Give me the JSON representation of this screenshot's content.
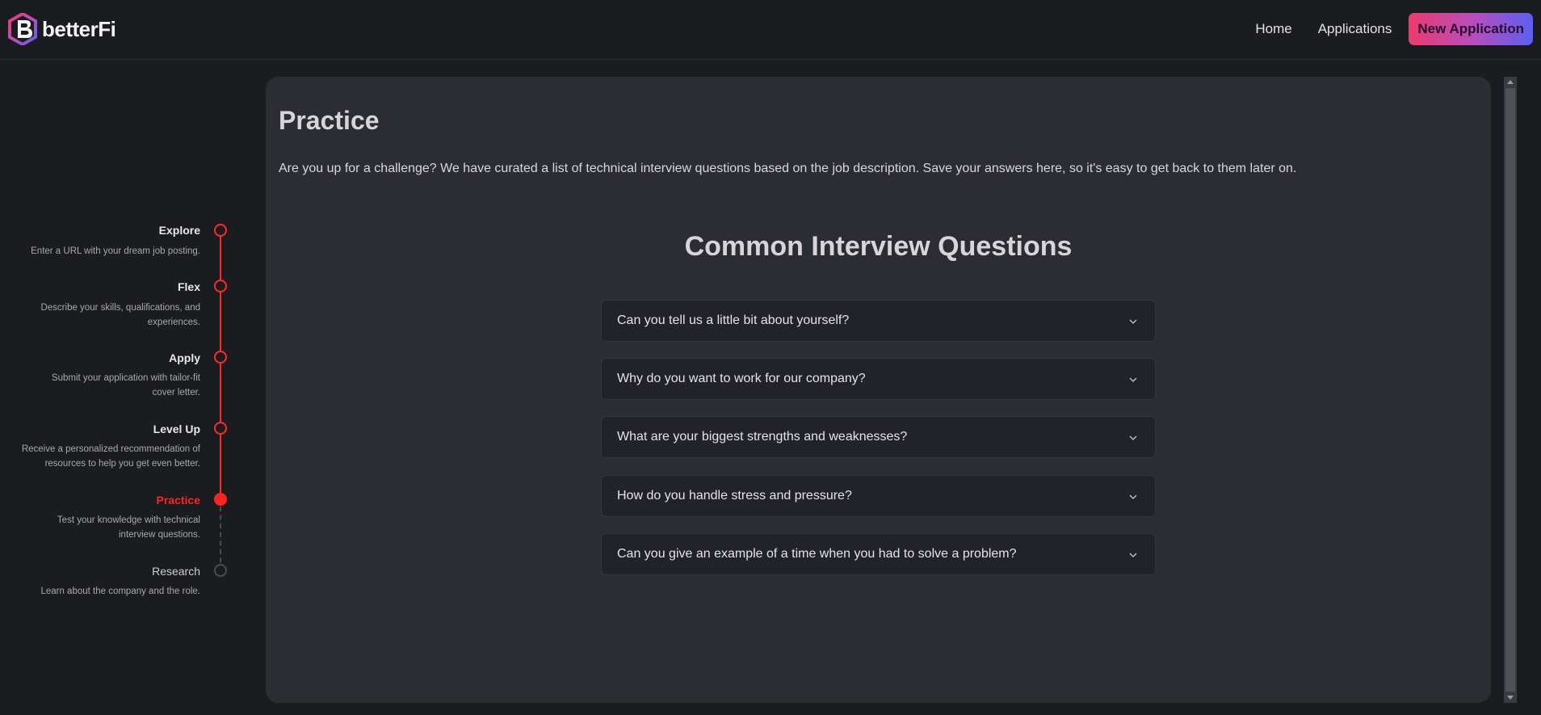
{
  "brand": {
    "name": "betterFi"
  },
  "nav": {
    "home": "Home",
    "applications": "Applications",
    "new_application": "New Application"
  },
  "stepper": {
    "steps": [
      {
        "title": "Explore",
        "desc": "Enter a URL with your dream job posting.",
        "state": "done"
      },
      {
        "title": "Flex",
        "desc": "Describe your skills, qualifications, and experiences.",
        "state": "done"
      },
      {
        "title": "Apply",
        "desc": "Submit your application with tailor-fit cover letter.",
        "state": "done"
      },
      {
        "title": "Level Up",
        "desc": "Receive a personalized recommendation of resources to help you get even better.",
        "state": "done"
      },
      {
        "title": "Practice",
        "desc": "Test your knowledge with technical interview questions.",
        "state": "active"
      },
      {
        "title": "Research",
        "desc": "Learn about the company and the role.",
        "state": "pending"
      }
    ]
  },
  "main": {
    "title": "Practice",
    "intro": "Are you up for a challenge? We have curated a list of technical interview questions based on the job description. Save your answers here, so it's easy to get back to them later on.",
    "section_title": "Common Interview Questions",
    "questions": [
      "Can you tell us a little bit about yourself?",
      "Why do you want to work for our company?",
      "What are your biggest strengths and weaknesses?",
      "How do you handle stress and pressure?",
      "Can you give an example of a time when you had to solve a problem?"
    ]
  },
  "colors": {
    "accent": "#ff2222",
    "background": "#1b1c20",
    "panel": "#2c2d32",
    "button_gradient_start": "#ec3b6e",
    "button_gradient_end": "#5b5ff2"
  },
  "icons": {
    "logo": "betterfi-logo-icon",
    "accordion": "chevron-down-icon"
  }
}
